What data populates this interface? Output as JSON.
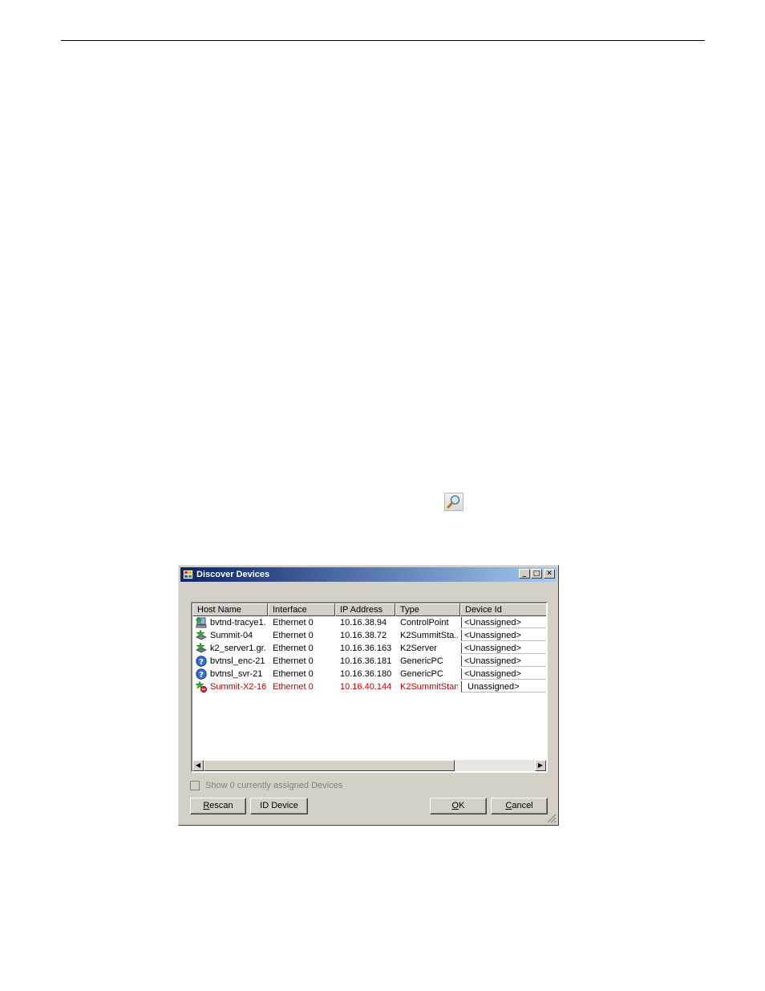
{
  "dialog": {
    "title": "Discover Devices",
    "controls": {
      "minimize": "_",
      "maximize": "□",
      "close": "✕"
    },
    "columns": [
      "Host Name",
      "Interface",
      "IP Address",
      "Type",
      "Device Id"
    ],
    "rows": [
      {
        "icon": "controlpoint-star-icon",
        "host": "bvtnd-tracye1...",
        "interface": "Ethernet 0",
        "ip": "10.16.38.94",
        "type": "ControlPoint",
        "device_id": "<Unassigned>",
        "status": "ok"
      },
      {
        "icon": "k2summit-star-icon",
        "host": "Summit-04",
        "interface": "Ethernet 0",
        "ip": "10.16.38.72",
        "type": "K2SummitSta...",
        "device_id": "<Unassigned>",
        "status": "ok"
      },
      {
        "icon": "k2server-star-icon",
        "host": "k2_server1.gr...",
        "interface": "Ethernet 0",
        "ip": "10.16.36.163",
        "type": "K2Server",
        "device_id": "<Unassigned>",
        "status": "ok"
      },
      {
        "icon": "question-icon",
        "host": "bvtnsl_enc-21",
        "interface": "Ethernet 0",
        "ip": "10.16.36.181",
        "type": "GenericPC",
        "device_id": "<Unassigned>",
        "status": "ok"
      },
      {
        "icon": "question-icon",
        "host": "bvtnsl_svr-21",
        "interface": "Ethernet 0",
        "ip": "10.16.36.180",
        "type": "GenericPC",
        "device_id": "<Unassigned>",
        "status": "ok"
      },
      {
        "icon": "error-star-icon",
        "host": "Summit-X2-16",
        "interface": "Ethernet 0",
        "ip": "10.16.40.144",
        "type": "K2SummitStan...",
        "device_id": "Unassigned>",
        "status": "error"
      }
    ],
    "checkbox_label": "Show 0 currently assigned Devices",
    "buttons": {
      "rescan": {
        "mnemonic": "R",
        "rest": "escan"
      },
      "id_device": "ID Device",
      "ok": {
        "mnemonic": "O",
        "rest": "K"
      },
      "cancel": {
        "mnemonic": "C",
        "rest": "ancel"
      }
    }
  },
  "colors": {
    "title_start": "#0a246a",
    "title_end": "#a6caf0",
    "error_text": "#c00000",
    "dialog_bg": "#d4d0c8"
  }
}
